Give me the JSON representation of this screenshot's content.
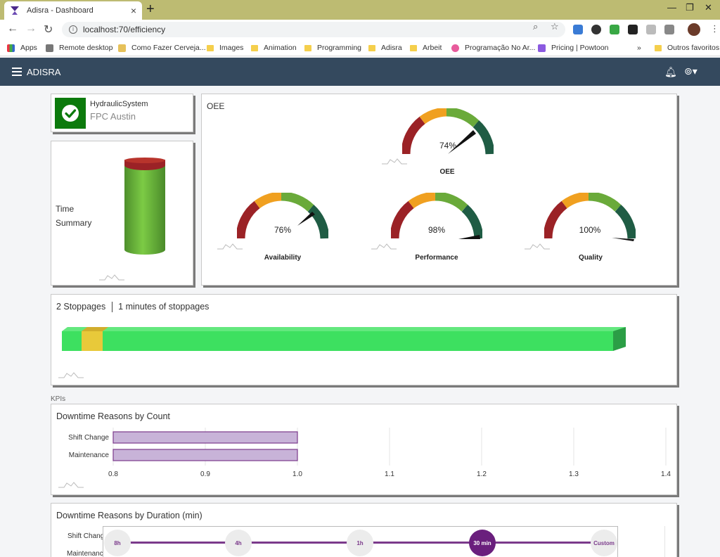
{
  "browser": {
    "tab_title": "Adisra - Dashboard",
    "url": "localhost:70/efficiency",
    "bookmarks": [
      "Apps",
      "Remote desktop",
      "Como Fazer Cerveja...",
      "Images",
      "Animation",
      "Programming",
      "Adisra",
      "Arbeit",
      "Programação No Ar...",
      "Pricing | Powtoon",
      "»",
      "Outros favoritos"
    ]
  },
  "app": {
    "name": "ADISRA"
  },
  "asset": {
    "name": "HydraulicSystem",
    "location": "FPC Austin",
    "status_color": "#0c7a0c"
  },
  "time_summary": {
    "label_line1": "Time",
    "label_line2": "Summary"
  },
  "oee": {
    "title": "OEE",
    "main": {
      "label": "OEE",
      "value_text": "74%",
      "value": 74
    },
    "sub": [
      {
        "label": "Availability",
        "value_text": "76%",
        "value": 76
      },
      {
        "label": "Performance",
        "value_text": "98%",
        "value": 98
      },
      {
        "label": "Quality",
        "value_text": "100%",
        "value": 100
      }
    ],
    "colors": {
      "red": "#9b2226",
      "orange": "#f0a020",
      "green": "#6aaa3a",
      "dark": "#1f5c44"
    }
  },
  "stoppages": {
    "count_text": "2 Stoppages",
    "duration_text": "1 minutes of stoppages",
    "bar_color": "#3de060",
    "stop_color": "#e8c93a"
  },
  "kpis_label": "KPIs",
  "chart_data": [
    {
      "type": "bar",
      "title": "Downtime Reasons by Count",
      "orientation": "horizontal",
      "categories": [
        "Shift Change",
        "Maintenance"
      ],
      "values": [
        1.0,
        1.0
      ],
      "xlim": [
        0.8,
        1.4
      ],
      "xticks": [
        "0.8",
        "0.9",
        "1.0",
        "1.1",
        "1.2",
        "1.3",
        "1.4"
      ],
      "bar_color": "#c8b3d8",
      "border_color": "#7b3a8b",
      "grid": true
    },
    {
      "type": "bar",
      "title": "Downtime Reasons by Duration (min)",
      "orientation": "horizontal",
      "categories": [
        "Shift Change",
        "Maintenance"
      ]
    }
  ],
  "time_range": {
    "options": [
      "8h",
      "4h",
      "1h",
      "30 min",
      "Custom"
    ],
    "selected": "30 min"
  }
}
